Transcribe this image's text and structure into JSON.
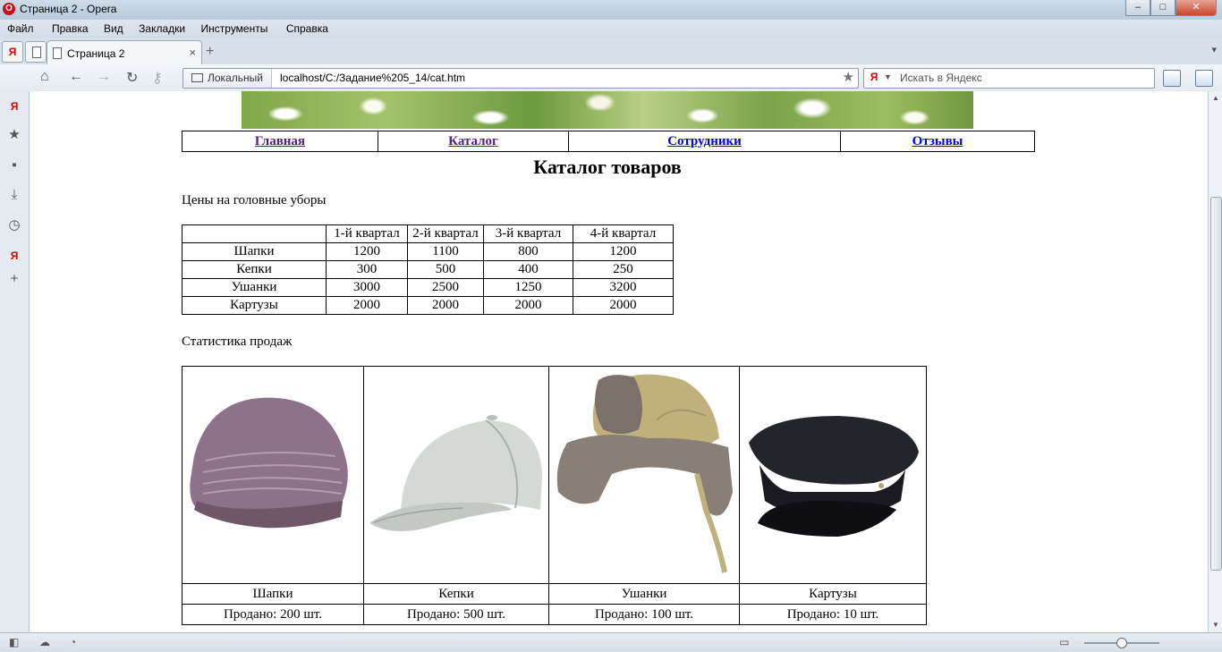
{
  "window": {
    "title": "Страница 2 - Opera"
  },
  "menu": [
    "Файл",
    "Правка",
    "Вид",
    "Закладки",
    "Инструменты",
    "Справка"
  ],
  "tab": {
    "label": "Страница 2"
  },
  "address": {
    "badge": "Локальный",
    "url": "localhost/C:/Задание%205_14/cat.htm",
    "search_placeholder": "Искать в Яндекс"
  },
  "page": {
    "nav": [
      "Главная",
      "Каталог",
      "Сотрудники",
      "Отзывы"
    ],
    "heading": "Каталог товаров",
    "prices_caption": "Цены на головные уборы",
    "price_table": {
      "header": [
        "",
        "1-й квартал",
        "2-й квартал",
        "3-й квартал",
        "4-й квартал"
      ],
      "rows": [
        [
          "Шапки",
          "1200",
          "1100",
          "800",
          "1200"
        ],
        [
          "Кепки",
          "300",
          "500",
          "400",
          "250"
        ],
        [
          "Ушанки",
          "3000",
          "2500",
          "1250",
          "3200"
        ],
        [
          "Картузы",
          "2000",
          "2000",
          "2000",
          "2000"
        ]
      ]
    },
    "stats_caption": "Статистика продаж",
    "products": [
      {
        "name": "Шапки",
        "sold": "Продано: 200 шт."
      },
      {
        "name": "Кепки",
        "sold": "Продано: 500 шт."
      },
      {
        "name": "Ушанки",
        "sold": "Продано: 100 шт."
      },
      {
        "name": "Картузы",
        "sold": "Продано: 10 шт."
      }
    ]
  }
}
